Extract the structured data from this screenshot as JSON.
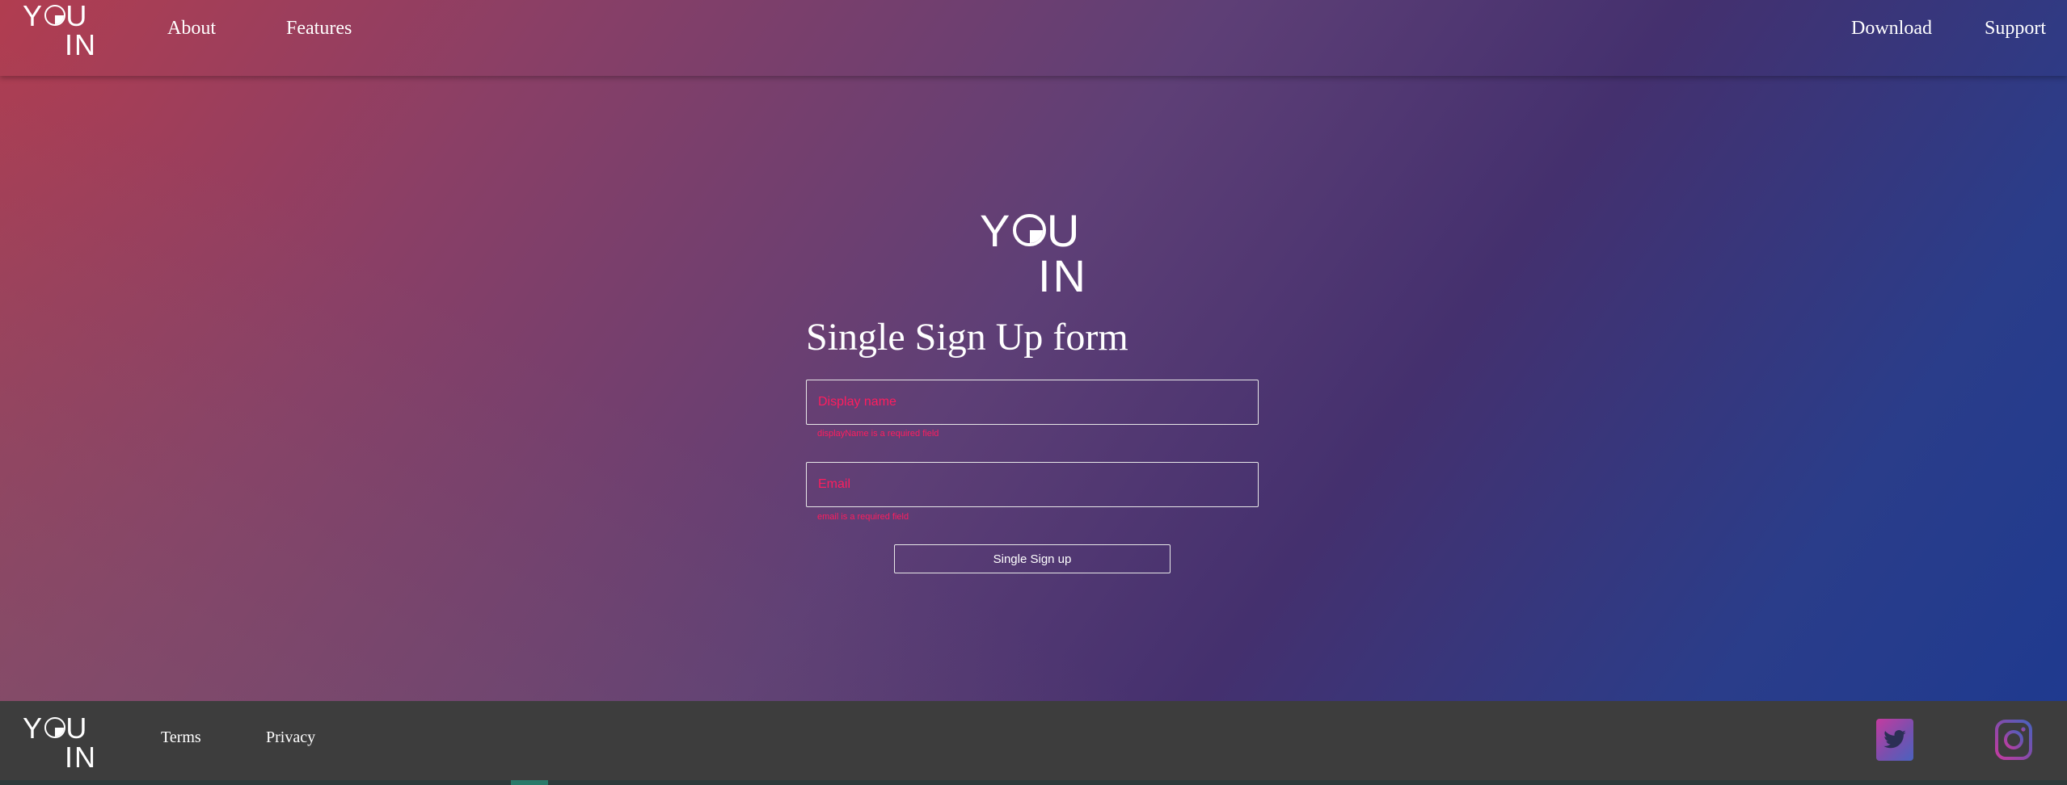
{
  "brand": {
    "logo_line1_a": "Y",
    "logo_line1_b": "U",
    "logo_line2": "IN"
  },
  "nav": {
    "left": [
      {
        "label": "About"
      },
      {
        "label": "Features"
      }
    ],
    "right": [
      {
        "label": "Download"
      },
      {
        "label": "Support"
      }
    ]
  },
  "form": {
    "title": "Single Sign Up form",
    "display_name": {
      "placeholder": "Display name",
      "value": "",
      "error": "displayName is a required field"
    },
    "email": {
      "placeholder": "Email",
      "value": "",
      "error": "email is a required field"
    },
    "submit_label": "Single Sign up"
  },
  "footer": {
    "links": [
      {
        "label": "Terms"
      },
      {
        "label": "Privacy"
      }
    ],
    "social": [
      {
        "icon": "twitter-icon"
      },
      {
        "icon": "instagram-icon"
      }
    ]
  },
  "colors": {
    "error": "#ff1d5e",
    "footer_bg": "#3d3d3d",
    "gradient_start": "#b13d50",
    "gradient_end": "#1f3a8f"
  }
}
